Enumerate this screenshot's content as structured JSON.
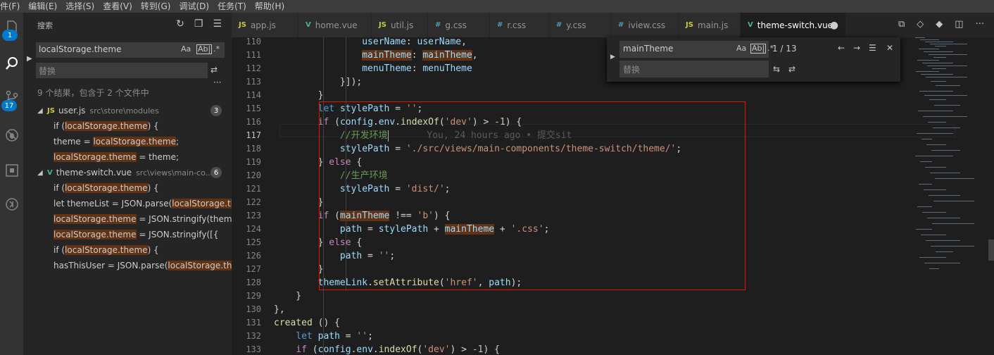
{
  "menubar": [
    "件(F)",
    "编辑(E)",
    "选择(S)",
    "查看(V)",
    "转到(G)",
    "调试(D)",
    "任务(T)",
    "帮助(H)"
  ],
  "activity": {
    "explorer_badge": "1",
    "scm_badge": "17"
  },
  "sidebar": {
    "title": "搜索",
    "search_value": "localStorage.theme",
    "opt_case": "Aa",
    "opt_word": "Ab|",
    "opt_regex": ".*",
    "replace_placeholder": "替换",
    "summary": "9 个结果，包含于 2 个文件中",
    "files": [
      {
        "icon": "JS",
        "name": "user.js",
        "path": "src\\store\\modules",
        "count": "3",
        "matches": [
          {
            "pre": "if (",
            "hl": "localStorage.theme",
            "post": ") {"
          },
          {
            "pre": "theme = ",
            "hl": "localStorage.theme",
            "post": ";"
          },
          {
            "pre": "",
            "hl": "localStorage.theme",
            "post": " = theme;"
          }
        ]
      },
      {
        "icon": "V",
        "name": "theme-switch.vue",
        "path": "src\\views\\main-co...",
        "count": "6",
        "matches": [
          {
            "pre": "if (",
            "hl": "localStorage.theme",
            "post": ") {"
          },
          {
            "pre": "let themeList = JSON.parse(",
            "hl": "localStorage.th...",
            "post": ""
          },
          {
            "pre": "",
            "hl": "localStorage.theme",
            "post": " = JSON.stringify(theme..."
          },
          {
            "pre": "",
            "hl": "localStorage.theme",
            "post": " = JSON.stringify([{"
          },
          {
            "pre": "if (",
            "hl": "localStorage.theme",
            "post": ") {"
          },
          {
            "pre": "hasThisUser = JSON.parse(",
            "hl": "localStorage.the...",
            "post": ""
          }
        ]
      }
    ]
  },
  "tabs": [
    {
      "icon": "JS",
      "label": "app.js",
      "active": false
    },
    {
      "icon": "V",
      "label": "home.vue",
      "active": false
    },
    {
      "icon": "JS",
      "label": "util.js",
      "active": false
    },
    {
      "icon": "#",
      "label": "g.css",
      "active": false
    },
    {
      "icon": "#",
      "label": "r.css",
      "active": false
    },
    {
      "icon": "#",
      "label": "y.css",
      "active": false
    },
    {
      "icon": "#",
      "label": "iview.css",
      "active": false
    },
    {
      "icon": "JS",
      "label": "main.js",
      "active": false
    },
    {
      "icon": "V",
      "label": "theme-switch.vue",
      "active": true
    }
  ],
  "colors": {
    "js_icon": "#cbcb41",
    "vue_icon": "#41b883",
    "css_icon": "#519aba",
    "red_box": "#e51400"
  },
  "find": {
    "value": "mainTheme",
    "replace_placeholder": "替换",
    "count": "1 / 13"
  },
  "editor": {
    "current_line": "117",
    "lines": [
      {
        "n": "110",
        "html": "<span class='var'>                userName</span>: <span class='var'>userName</span>,"
      },
      {
        "n": "111",
        "html": "                <span class='var mark'>mainTheme</span>: <span class='var mark'>mainTheme</span>,"
      },
      {
        "n": "112",
        "html": "                <span class='var'>menuTheme</span>: <span class='var'>menuTheme</span>"
      },
      {
        "n": "113",
        "html": "            }]);"
      },
      {
        "n": "114",
        "html": "        }"
      },
      {
        "n": "115",
        "html": "        <span class='kw'>let</span> <span class='var'>stylePath</span> = <span class='str'>''</span>;"
      },
      {
        "n": "116",
        "html": "        <span class='kc'>if</span> (<span class='var'>config</span>.<span class='var'>env</span>.<span class='fn'>indexOf</span>(<span class='str'>'dev'</span>) &gt; <span class='num'>-1</span>) {"
      },
      {
        "n": "117",
        "html": "            <span class='cmt'>//开发环境</span><span class='caret-bar'></span>       <span class='blame'>You, 24 hours ago • 提交sit</span>"
      },
      {
        "n": "118",
        "html": "            <span class='var'>stylePath</span> = <span class='str'>'./src/views/main-components/theme-switch/theme/'</span>;"
      },
      {
        "n": "119",
        "html": "        } <span class='kc'>else</span> {"
      },
      {
        "n": "120",
        "html": "            <span class='cmt'>//生产环境</span>"
      },
      {
        "n": "121",
        "html": "            <span class='var'>stylePath</span> = <span class='str'>'dist/'</span>;"
      },
      {
        "n": "122",
        "html": "        }"
      },
      {
        "n": "123",
        "html": "        <span class='kc'>if</span> (<span class='var mark'>mainTheme</span> !== <span class='str'>'b'</span>) {"
      },
      {
        "n": "124",
        "html": "            <span class='var'>path</span> = <span class='var'>stylePath</span> + <span class='var mark'>mainTheme</span> + <span class='str'>'.css'</span>;"
      },
      {
        "n": "125",
        "html": "        } <span class='kc'>else</span> {"
      },
      {
        "n": "126",
        "html": "            <span class='var'>path</span> = <span class='str'>''</span>;"
      },
      {
        "n": "127",
        "html": "        }"
      },
      {
        "n": "128",
        "html": "        <span class='var'>themeLink</span>.<span class='fn'>setAttribute</span>(<span class='str'>'href'</span>, <span class='var'>path</span>);"
      },
      {
        "n": "129",
        "html": "    }"
      },
      {
        "n": "130",
        "html": "},"
      },
      {
        "n": "131",
        "html": "<span class='fn'>created</span> () {"
      },
      {
        "n": "132",
        "html": "    <span class='kw'>let</span> <span class='var'>path</span> = <span class='str'>''</span>;"
      },
      {
        "n": "133",
        "html": "    <span class='kc'>if</span> (<span class='var'>config</span>.<span class='var'>env</span>.<span class='fn'>indexOf</span>(<span class='str'>'dev'</span>) &gt; <span class='num'>-1</span>) {"
      }
    ]
  }
}
